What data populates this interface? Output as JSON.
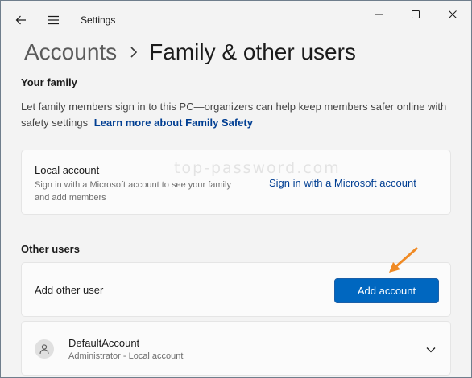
{
  "colors": {
    "accent": "#0067c0",
    "link": "#003e92",
    "arrow": "#f08a24",
    "window_bg": "#f3f3f3",
    "card_bg": "#fbfbfb"
  },
  "titlebar": {
    "title": "Settings",
    "back_icon": "back-arrow-icon",
    "menu_icon": "hamburger-menu-icon",
    "minimize_icon": "minimize-icon",
    "maximize_icon": "maximize-icon",
    "close_icon": "close-icon"
  },
  "breadcrumb": {
    "parent": "Accounts",
    "separator_icon": "chevron-right-icon",
    "current": "Family & other users"
  },
  "your_family": {
    "header": "Your family",
    "description": "Let family members sign in to this PC—organizers can help keep members safer online with safety settings",
    "link": "Learn more about Family Safety",
    "local_account": {
      "title": "Local account",
      "subtitle": "Sign in with a Microsoft account to see your family and add members",
      "action_link": "Sign in with a Microsoft account"
    }
  },
  "watermark": "top-password.com",
  "other_users": {
    "header": "Other users",
    "add_label": "Add other user",
    "add_button": "Add account",
    "annotation_icon": "orange-arrow-icon",
    "users": [
      {
        "name": "DefaultAccount",
        "role": "Administrator - Local account",
        "avatar_icon": "person-icon",
        "expand_icon": "chevron-down-icon"
      }
    ]
  }
}
